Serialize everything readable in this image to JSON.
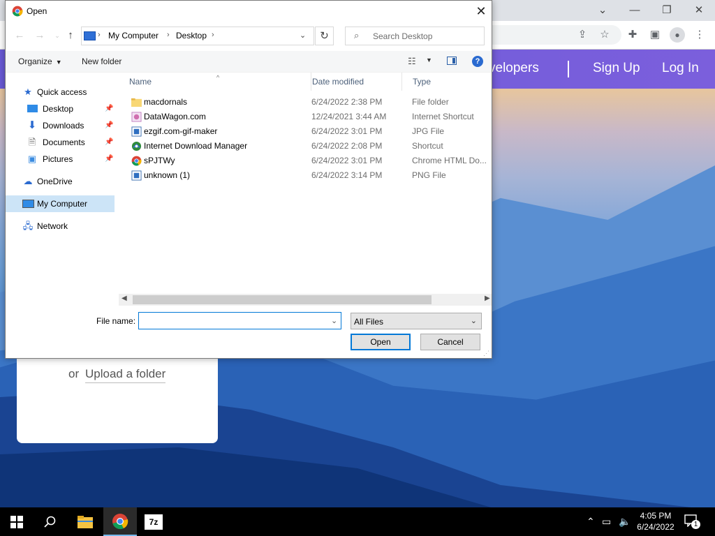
{
  "browser": {
    "nav_links": [
      "velopers",
      "Sign Up",
      "Log In"
    ],
    "upload": {
      "or": "or",
      "folder_link": "Upload a folder"
    },
    "profile_initial": "",
    "window_controls": [
      "chevron-down-icon",
      "minimize-icon",
      "restore-icon",
      "close-icon"
    ]
  },
  "dialog": {
    "title": "Open",
    "breadcrumb": [
      "My Computer",
      "Desktop"
    ],
    "search_placeholder": "Search Desktop",
    "commands": {
      "organize": "Organize",
      "new_folder": "New folder"
    },
    "nav_items": [
      {
        "label": "Quick access",
        "icon": "star-icon",
        "pinned": false
      },
      {
        "label": "Desktop",
        "icon": "desktop-icon",
        "pinned": true
      },
      {
        "label": "Downloads",
        "icon": "download-icon",
        "pinned": true
      },
      {
        "label": "Documents",
        "icon": "document-icon",
        "pinned": true
      },
      {
        "label": "Pictures",
        "icon": "picture-icon",
        "pinned": true
      },
      {
        "label": "OneDrive",
        "icon": "cloud-icon",
        "pinned": false
      },
      {
        "label": "My Computer",
        "icon": "computer-icon",
        "pinned": false,
        "selected": true
      },
      {
        "label": "Network",
        "icon": "network-icon",
        "pinned": false
      }
    ],
    "columns": [
      "Name",
      "Date modified",
      "Type"
    ],
    "files": [
      {
        "name": "macdornals",
        "date": "6/24/2022 2:38 PM",
        "type": "File folder",
        "icon": "folder-icon"
      },
      {
        "name": "DataWagon.com",
        "date": "12/24/2021 3:44 AM",
        "type": "Internet Shortcut",
        "icon": "internet-shortcut-icon"
      },
      {
        "name": "ezgif.com-gif-maker",
        "date": "6/24/2022 3:01 PM",
        "type": "JPG File",
        "icon": "image-file-icon"
      },
      {
        "name": "Internet Download Manager",
        "date": "6/24/2022 2:08 PM",
        "type": "Shortcut",
        "icon": "idm-shortcut-icon"
      },
      {
        "name": "sPJTWy",
        "date": "6/24/2022 3:01 PM",
        "type": "Chrome HTML Do...",
        "icon": "chrome-icon"
      },
      {
        "name": "unknown (1)",
        "date": "6/24/2022 3:14 PM",
        "type": "PNG File",
        "icon": "image-file-icon"
      }
    ],
    "file_name_label": "File name:",
    "file_name_value": "",
    "file_type": "All Files",
    "open_label": "Open",
    "cancel_label": "Cancel"
  },
  "taskbar": {
    "time": "4:05 PM",
    "date": "6/24/2022",
    "notification_count": "1"
  },
  "colors": {
    "accent": "#0078d7",
    "selection": "#cce4f7",
    "nav_bar": "#7b5fdc"
  }
}
